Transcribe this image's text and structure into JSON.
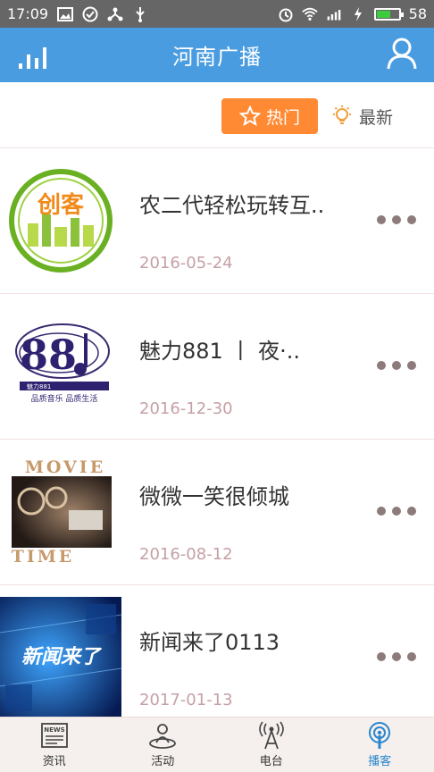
{
  "status_bar": {
    "time": "17:09",
    "battery": "58"
  },
  "app": {
    "title": "河南广播"
  },
  "filter": {
    "hot_label": "热门",
    "new_label": "最新"
  },
  "items": [
    {
      "title": "农二代轻松玩转互..",
      "date": "2016-05-24",
      "thumb_text": "创客"
    },
    {
      "title": "魅力881 丨 夜·..",
      "date": "2016-12-30",
      "thumb_text": "品质音乐  品质生活",
      "thumb_sub": "魅力881"
    },
    {
      "title": "微微一笑很倾城",
      "date": "2016-08-12",
      "thumb_top": "MOVIE",
      "thumb_bottom": "TIME"
    },
    {
      "title": "新闻来了0113",
      "date": "2017-01-13",
      "thumb_text": "新闻来了"
    }
  ],
  "tabs": [
    {
      "label": "资讯",
      "icon": "news-icon"
    },
    {
      "label": "活动",
      "icon": "activity-icon"
    },
    {
      "label": "电台",
      "icon": "radio-tower-icon"
    },
    {
      "label": "播客",
      "icon": "podcast-icon",
      "active": true
    }
  ],
  "colors": {
    "primary": "#4a9ce0",
    "accent": "#ff8a33",
    "active_tab": "#2a86cf",
    "date": "#c5a0a6"
  }
}
